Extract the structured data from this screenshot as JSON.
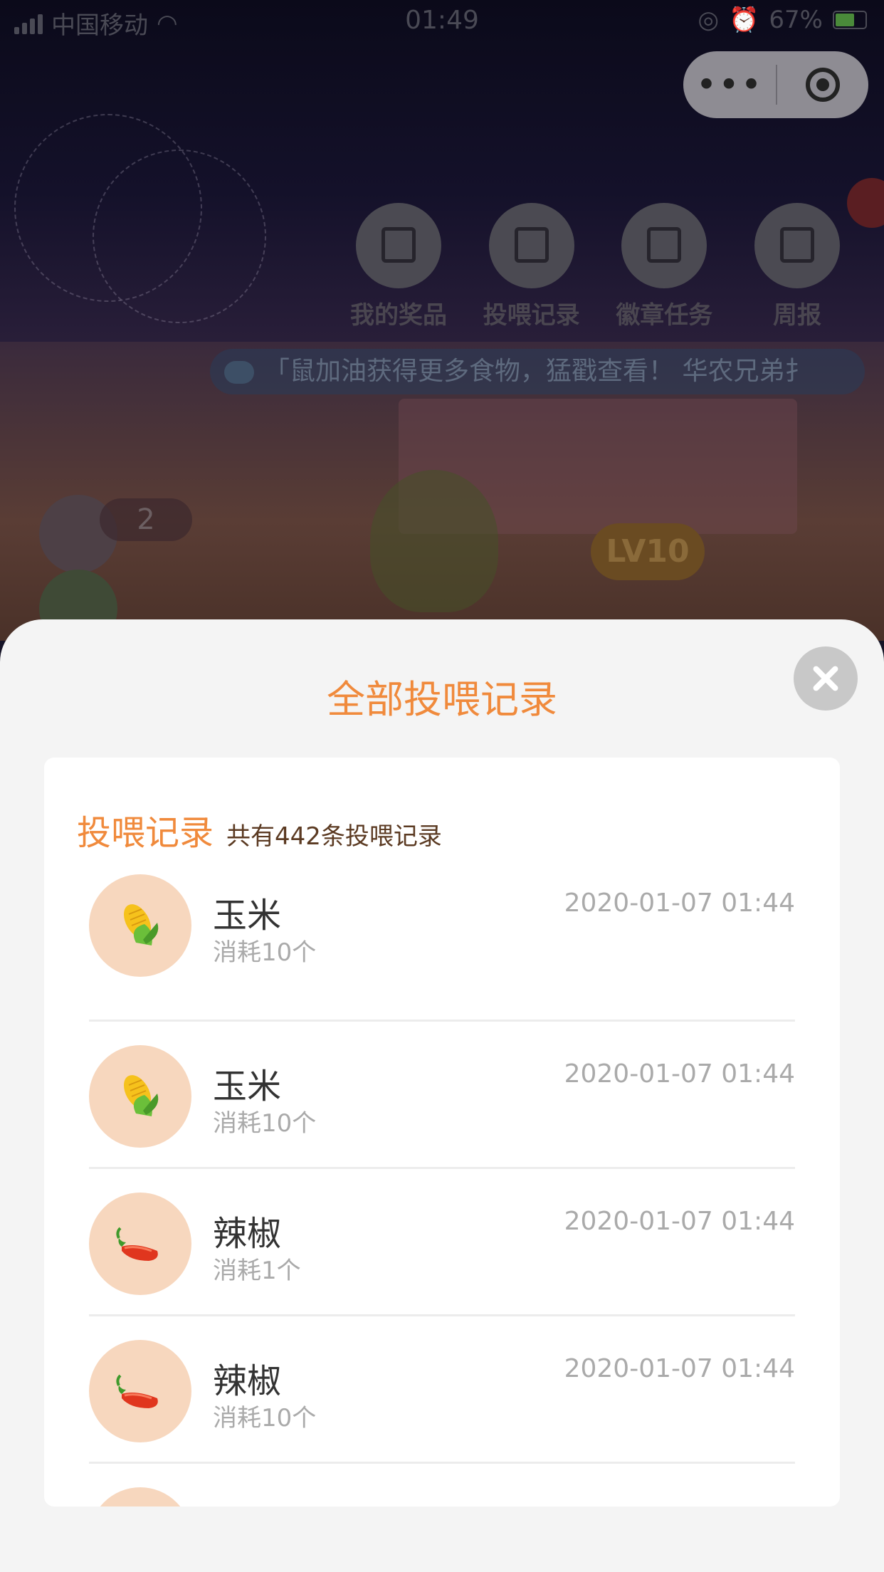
{
  "status_bar": {
    "carrier": "中国移动",
    "time": "01:49",
    "battery": "67%"
  },
  "capsule": {
    "more": "•••"
  },
  "nav": [
    {
      "label": "我的奖品",
      "icon": "gift-icon"
    },
    {
      "label": "投喂记录",
      "icon": "list-icon"
    },
    {
      "label": "徽章任务",
      "icon": "badge-icon"
    },
    {
      "label": "周报",
      "icon": "calendar-icon"
    }
  ],
  "ticker": {
    "text": "「鼠加油获得更多食物，猛戳查看！   华农兄弟扌"
  },
  "scene": {
    "count": "2",
    "level": "LV10"
  },
  "sheet": {
    "title": "全部投喂记录",
    "card_title": "投喂记录",
    "card_subtitle": "共有442条投喂记录",
    "records": [
      {
        "name": "玉米",
        "used": "消耗10个",
        "time": "2020-01-07 01:44",
        "icon": "corn-icon"
      },
      {
        "name": "玉米",
        "used": "消耗10个",
        "time": "2020-01-07 01:44",
        "icon": "corn-icon"
      },
      {
        "name": "辣椒",
        "used": "消耗1个",
        "time": "2020-01-07 01:44",
        "icon": "chili-icon"
      },
      {
        "name": "辣椒",
        "used": "消耗10个",
        "time": "2020-01-07 01:44",
        "icon": "chili-icon"
      },
      {
        "name": "",
        "used": "",
        "time": "",
        "icon": ""
      }
    ]
  },
  "colors": {
    "accent": "#f08a3c",
    "icon_bg": "#f7d7be"
  }
}
